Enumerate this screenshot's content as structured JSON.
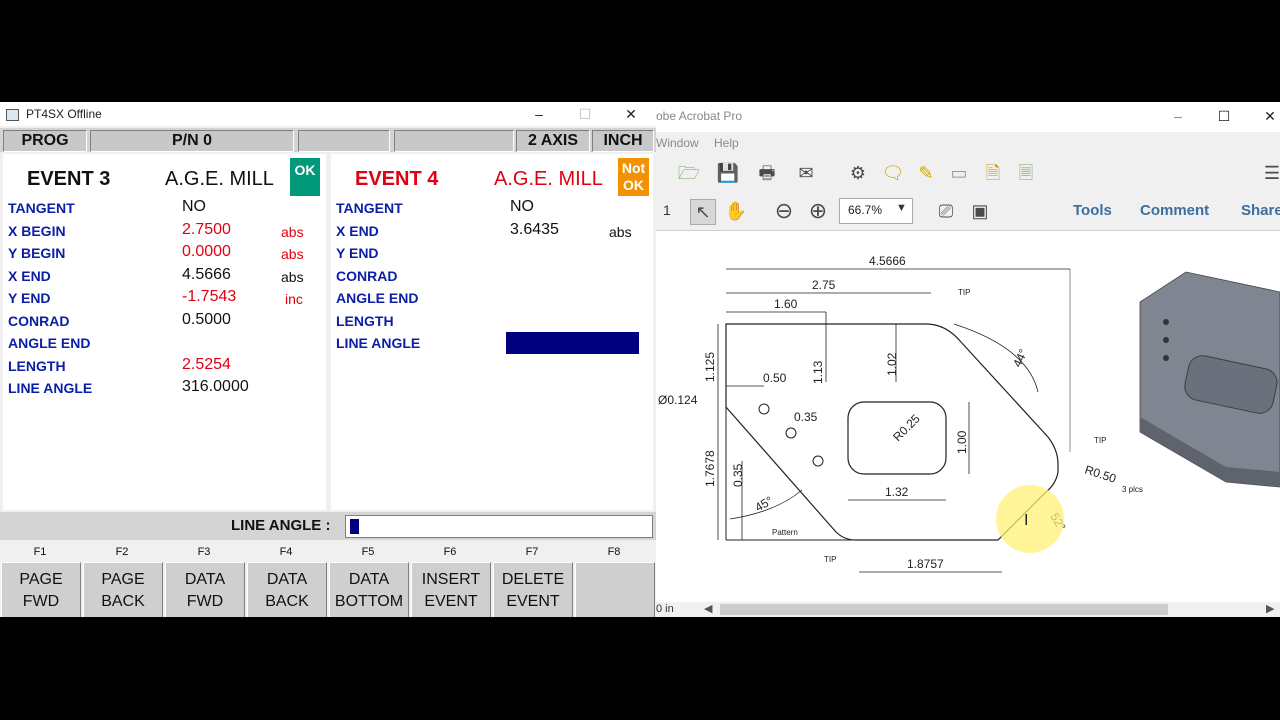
{
  "pt_window": {
    "title": "PT4SX Offline",
    "status_bar": {
      "mode": "PROG",
      "program": "P/N 0",
      "slot3": "",
      "slot4": "",
      "axis": "2 AXIS",
      "units": "INCH"
    },
    "left_event": {
      "title": "EVENT 3",
      "type": "A.G.E. MILL",
      "badge": "OK",
      "rows": [
        {
          "label": "TANGENT",
          "value": "NO",
          "unit": ""
        },
        {
          "label": "X BEGIN",
          "value": "2.7500",
          "unit": "abs"
        },
        {
          "label": "Y BEGIN",
          "value": "0.0000",
          "unit": "abs"
        },
        {
          "label": "X END",
          "value": "4.5666",
          "unit": "abs"
        },
        {
          "label": "Y END",
          "value": "-1.7543",
          "unit": "inc"
        },
        {
          "label": "CONRAD",
          "value": "0.5000",
          "unit": ""
        },
        {
          "label": "ANGLE END",
          "value": "",
          "unit": ""
        },
        {
          "label": "LENGTH",
          "value": "2.5254",
          "unit": ""
        },
        {
          "label": "LINE ANGLE",
          "value": "316.0000",
          "unit": ""
        }
      ]
    },
    "right_event": {
      "title": "EVENT 4",
      "type": "A.G.E. MILL",
      "badge_line1": "Not",
      "badge_line2": "OK",
      "rows": [
        {
          "label": "TANGENT",
          "value": "NO",
          "unit": ""
        },
        {
          "label": "X END",
          "value": "3.6435",
          "unit": "abs"
        },
        {
          "label": "Y END",
          "value": "",
          "unit": ""
        },
        {
          "label": "CONRAD",
          "value": "",
          "unit": ""
        },
        {
          "label": "ANGLE END",
          "value": "",
          "unit": ""
        },
        {
          "label": "LENGTH",
          "value": "",
          "unit": ""
        },
        {
          "label": "LINE ANGLE",
          "value": "",
          "unit": ""
        }
      ]
    },
    "prompt_label": "LINE ANGLE :",
    "prompt_value": "",
    "fkeys": [
      {
        "num": "F1",
        "line1": "PAGE",
        "line2": "FWD"
      },
      {
        "num": "F2",
        "line1": "PAGE",
        "line2": "BACK"
      },
      {
        "num": "F3",
        "line1": "DATA",
        "line2": "FWD"
      },
      {
        "num": "F4",
        "line1": "DATA",
        "line2": "BACK"
      },
      {
        "num": "F5",
        "line1": "DATA",
        "line2": "BOTTOM"
      },
      {
        "num": "F6",
        "line1": "INSERT",
        "line2": "EVENT"
      },
      {
        "num": "F7",
        "line1": "DELETE",
        "line2": "EVENT"
      },
      {
        "num": "F8",
        "line1": "",
        "line2": ""
      }
    ],
    "colors": {
      "label_blue": "#0b1ea8",
      "value_red": "#e00012",
      "ok_green": "#00997a",
      "notok_orange": "#f39200",
      "highlight_navy": "#00007f"
    }
  },
  "acrobat": {
    "title": "obe Acrobat Pro",
    "menu": [
      "Window",
      "Help"
    ],
    "page_num": "1",
    "zoom": "66.7%",
    "panels": [
      "Tools",
      "Comment",
      "Share"
    ],
    "status_left": "0 in",
    "drawing": {
      "dims": [
        "4.5666",
        "2.75",
        "1.60",
        "1.125",
        "1.13",
        "1.02",
        "0.50",
        "0.35",
        "0.35",
        "1.7678",
        "1.00",
        "1.32",
        "1.8757"
      ],
      "diameter": "Ø0.124",
      "radii": [
        "R0.25",
        "R0.50"
      ],
      "angles": [
        "44°",
        "45°",
        "52°"
      ],
      "notes": [
        "TIP",
        "TIP",
        "TIP",
        "Pattern",
        "3 plcs"
      ]
    }
  }
}
